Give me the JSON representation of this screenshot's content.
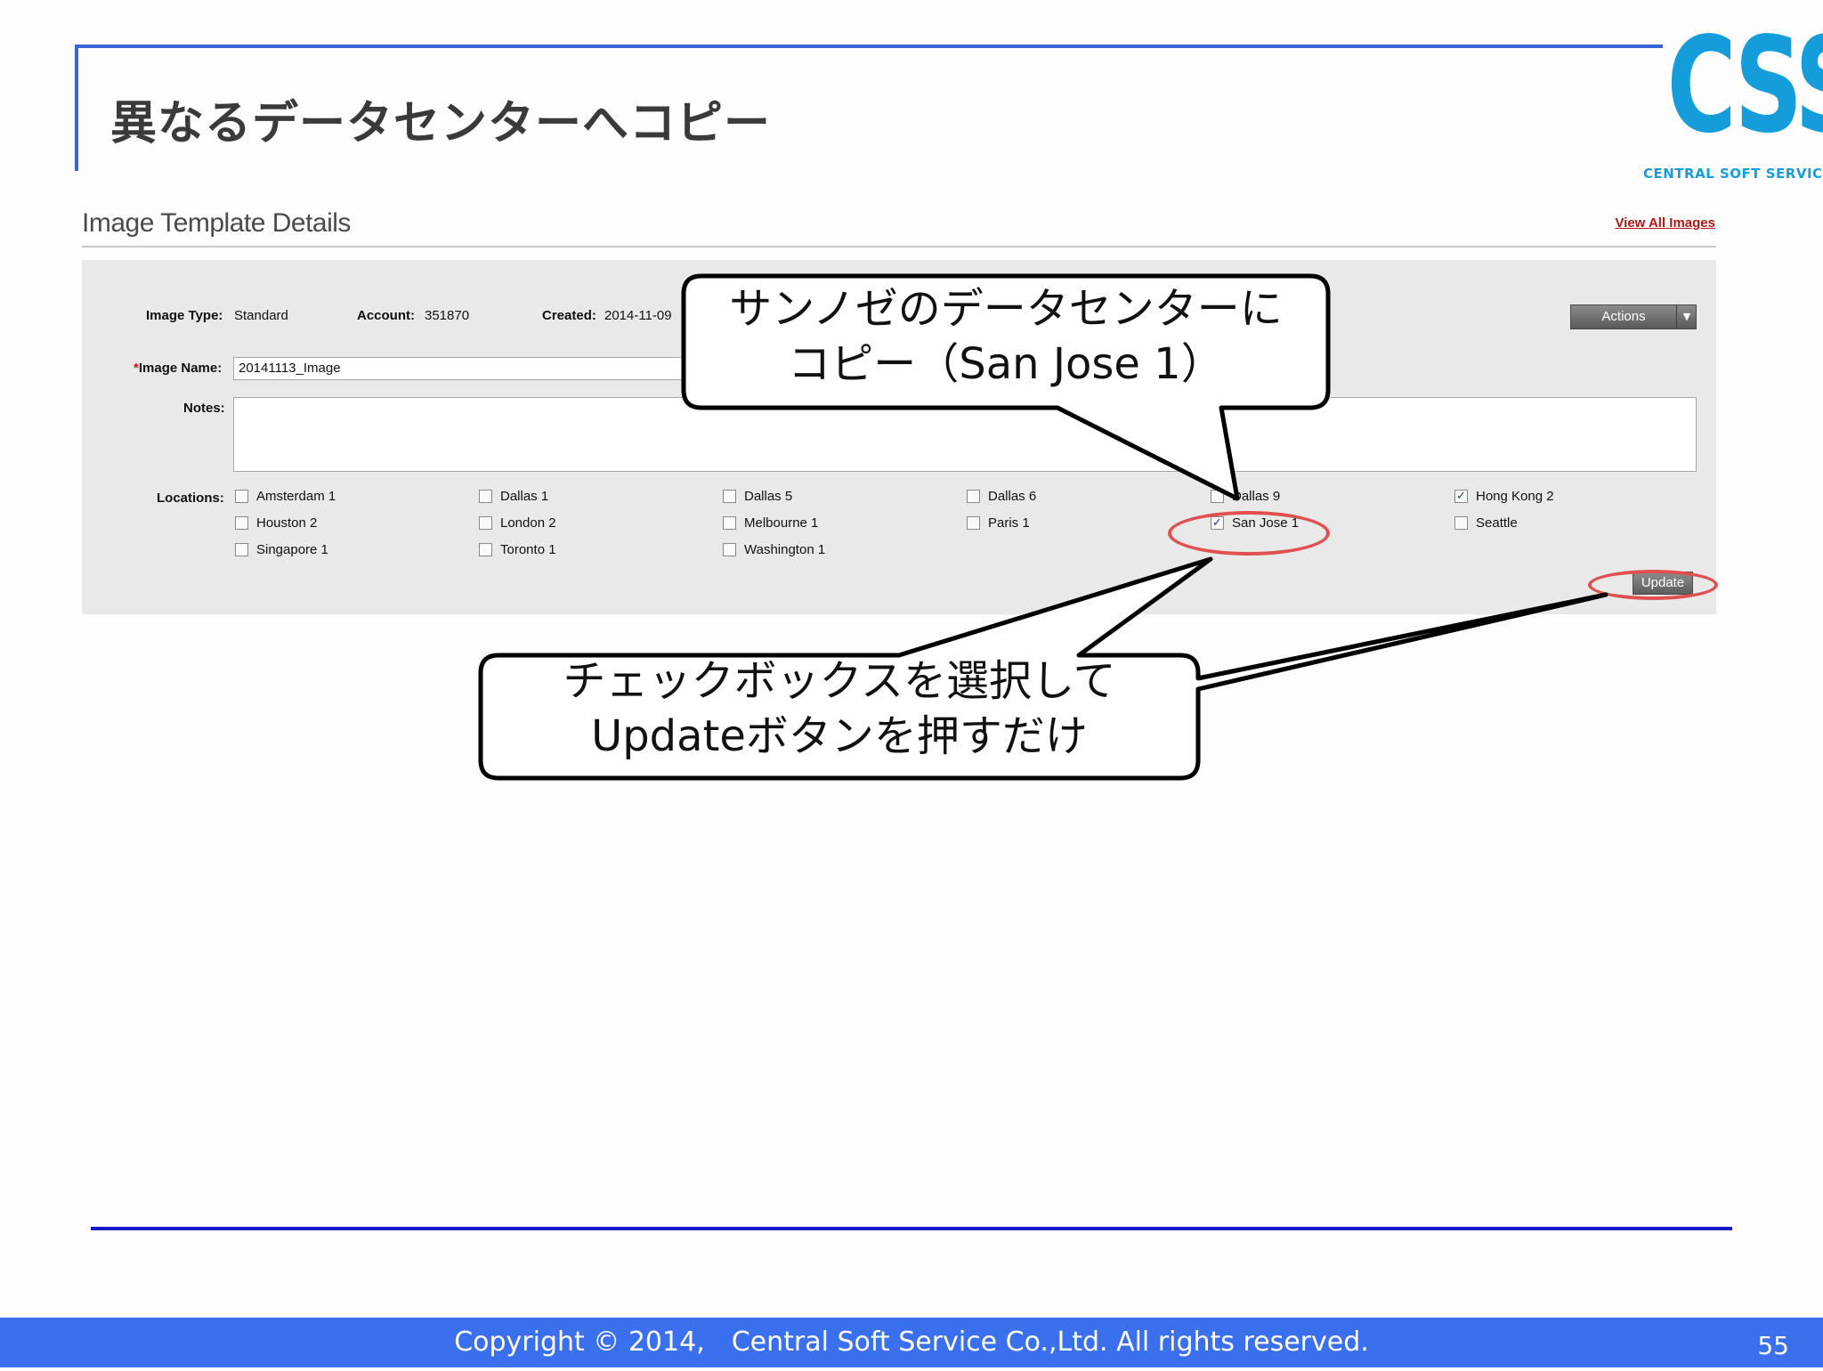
{
  "slide": {
    "title": "異なるデータセンターへコピー",
    "page_number": "55",
    "footer": "Copyright © 2014,　Central Soft Service Co.,Ltd. All rights reserved.",
    "logo": {
      "letters": "CSS",
      "subtitle": "CENTRAL SOFT SERVICE",
      "color": "#159ddb"
    }
  },
  "details": {
    "title": "Image Template Details",
    "view_all_link": "View All Images",
    "image_type_label": "Image Type:",
    "image_type_value": "Standard",
    "account_label": "Account:",
    "account_value": "351870",
    "created_label": "Created:",
    "created_value": "2014-11-09",
    "required_mark": "*",
    "image_name_label": "Image Name:",
    "image_name_value": "20141113_Image",
    "notes_label": "Notes:",
    "notes_value": "",
    "actions_label": "Actions",
    "locations_label": "Locations:",
    "locations": [
      {
        "label": "Amsterdam 1",
        "checked": false
      },
      {
        "label": "Dallas 1",
        "checked": false
      },
      {
        "label": "Dallas 5",
        "checked": false
      },
      {
        "label": "Dallas 6",
        "checked": false
      },
      {
        "label": "Dallas 9",
        "checked": false
      },
      {
        "label": "Hong Kong 2",
        "checked": true
      },
      {
        "label": "Houston 2",
        "checked": false
      },
      {
        "label": "London 2",
        "checked": false
      },
      {
        "label": "Melbourne 1",
        "checked": false
      },
      {
        "label": "Paris 1",
        "checked": false
      },
      {
        "label": "San Jose 1",
        "checked": true
      },
      {
        "label": "Seattle",
        "checked": false
      },
      {
        "label": "Singapore 1",
        "checked": false
      },
      {
        "label": "Toronto 1",
        "checked": false
      },
      {
        "label": "Washington 1",
        "checked": false
      }
    ],
    "update_button": "Update"
  },
  "callouts": {
    "top": {
      "line1": "サンノゼのデータセンターに",
      "line2": "コピー（San Jose 1）"
    },
    "bottom": {
      "line1": "チェックボックスを選択して",
      "line2": "Updateボタンを押すだけ"
    }
  },
  "colors": {
    "accent_blue": "#3a63d8",
    "footer_blue": "#3a6fee",
    "highlight_red": "#e05050",
    "link_red": "#b01818"
  }
}
